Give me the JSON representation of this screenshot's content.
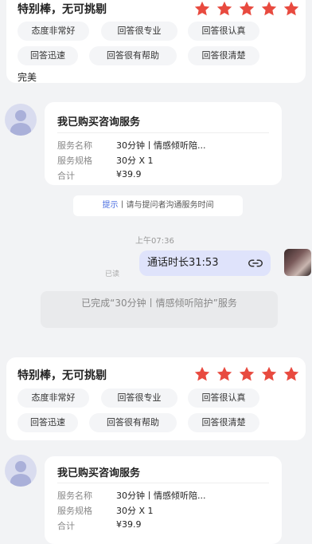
{
  "review1": {
    "title": "特别棒，无可挑剔",
    "stars": 5,
    "tags": [
      "态度非常好",
      "回答很专业",
      "回答很认真",
      "回答迅速",
      "回答很有帮助",
      "回答很清楚"
    ],
    "comment": "完美"
  },
  "order1": {
    "title": "我已购买咨询服务",
    "rows": [
      {
        "label": "服务名称",
        "value": "30分钟丨情感倾听陪..."
      },
      {
        "label": "服务规格",
        "value": "30分 X 1"
      },
      {
        "label": "合计",
        "value": "¥39.9"
      }
    ]
  },
  "hint": {
    "highlight": "提示",
    "text": "丨请与提问者沟通服务时间"
  },
  "message": {
    "time": "上午07:36",
    "text": "通话时长31:53",
    "read": "已读"
  },
  "completed_text": "已完成“30分钟丨情感倾听陪护”服务",
  "review2": {
    "title": "特别棒，无可挑剔",
    "stars": 5,
    "tags": [
      "态度非常好",
      "回答很专业",
      "回答很认真",
      "回答迅速",
      "回答很有帮助",
      "回答很清楚"
    ]
  },
  "order2": {
    "title": "我已购买咨询服务",
    "rows": [
      {
        "label": "服务名称",
        "value": "30分钟丨情感倾听陪..."
      },
      {
        "label": "服务规格",
        "value": "30分 X 1"
      },
      {
        "label": "合计",
        "value": "¥39.9"
      }
    ]
  },
  "colors": {
    "star": "#e84a3f",
    "bubble": "#dfe3fb",
    "highlight": "#4a6ee0",
    "background": "#f2f3f5"
  }
}
